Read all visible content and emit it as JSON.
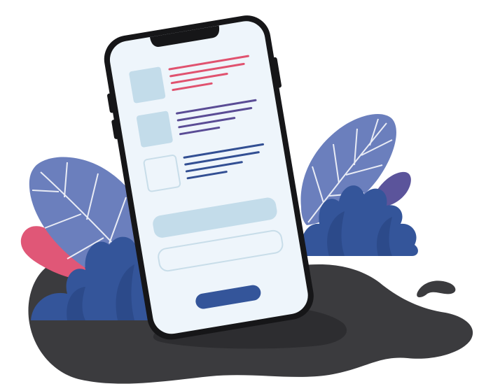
{
  "illustration": {
    "subject": "smartphone-list-ui",
    "palette": {
      "ground": "#3b3b3e",
      "ground_shadow": "#2d2d30",
      "leaf_periwinkle": "#6b7fbd",
      "leaf_vein": "#ffffff",
      "bush_blue": "#34559a",
      "leaf_pink": "#e05777",
      "leaf_purple": "#5b549b",
      "phone_frame": "#161618",
      "phone_screen": "#eef5fb",
      "ui_box": "#c3dcea",
      "ui_box_outline": "#c8dde9",
      "line_pink": "#e0526f",
      "line_purple": "#5a4c95",
      "line_blue": "#324f93",
      "cta_button": "#34559a"
    },
    "icons": {
      "phone": "smartphone-icon",
      "list_thumb_1": "image-placeholder-icon",
      "list_thumb_2": "image-placeholder-icon",
      "list_thumb_3": "image-placeholder-icon"
    }
  }
}
